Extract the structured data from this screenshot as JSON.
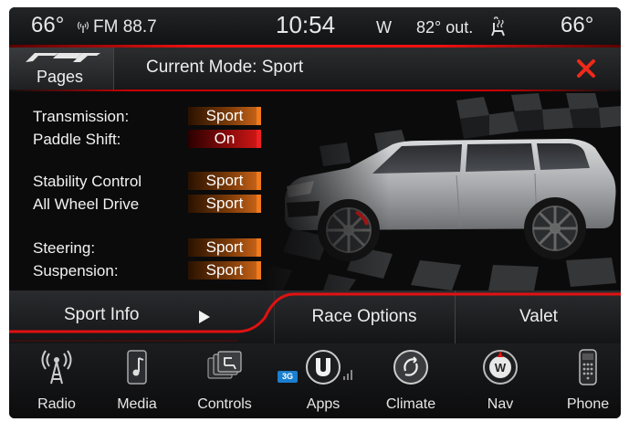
{
  "status_bar": {
    "temp_left": "66°",
    "radio": "FM 88.7",
    "clock": "10:54",
    "compass": "W",
    "outside_temp": "82° out.",
    "temp_right": "66°"
  },
  "header": {
    "pages_label": "Pages",
    "mode_title": "Current Mode: Sport"
  },
  "settings": [
    {
      "label": "Transmission:",
      "value": "Sport"
    },
    {
      "label": "Paddle Shift:",
      "value": "On"
    },
    {
      "label": "Stability Control",
      "value": "Sport"
    },
    {
      "label": "All Wheel Drive",
      "value": "Sport"
    },
    {
      "label": "Steering:",
      "value": "Sport"
    },
    {
      "label": "Suspension:",
      "value": "Sport"
    }
  ],
  "menu": {
    "sport_info": "Sport Info",
    "race_options": "Race Options",
    "valet": "Valet"
  },
  "dock": [
    {
      "label": "Radio",
      "icon": "radio-tower-icon"
    },
    {
      "label": "Media",
      "icon": "media-icon"
    },
    {
      "label": "Controls",
      "icon": "controls-icon"
    },
    {
      "label": "Apps",
      "icon": "uconnect-apps-icon",
      "badge": "3G"
    },
    {
      "label": "Climate",
      "icon": "climate-icon"
    },
    {
      "label": "Nav",
      "icon": "nav-compass-icon"
    },
    {
      "label": "Phone",
      "icon": "phone-icon"
    }
  ],
  "colors": {
    "accent_red": "#e11111",
    "value_orange": "#d0671a",
    "background": "#0d0d0e"
  }
}
